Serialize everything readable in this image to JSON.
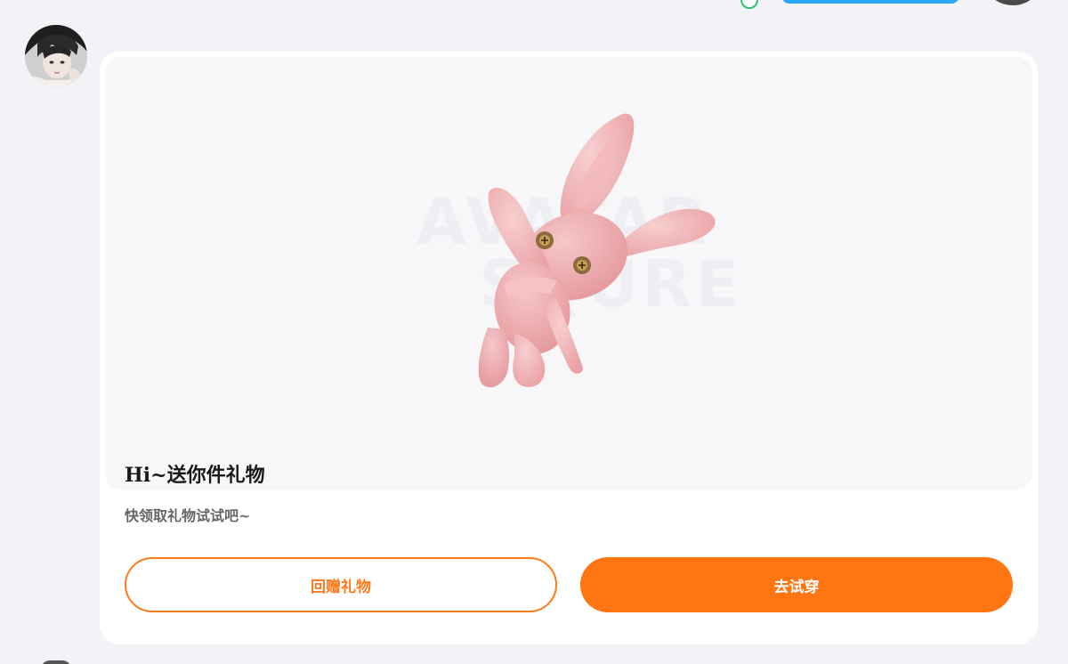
{
  "gift_card": {
    "title": "Hi~送你件礼物",
    "subtitle": "快领取礼物试试吧~",
    "return_gift_label": "回赠礼物",
    "try_on_label": "去试穿"
  },
  "watermark": {
    "line1": "AVATAR",
    "line2": "SQURE"
  },
  "colors": {
    "accent_orange": "#ff7512",
    "page_background": "#f2f3f7",
    "card_background": "#ffffff",
    "bunny_pink": "#f2b3b5",
    "top_pill_blue": "#2aa8f5",
    "status_green": "#2cc36b"
  },
  "icons": [
    "sender-avatar",
    "bunny-plush-image",
    "online-status-icon",
    "user-avatar"
  ]
}
